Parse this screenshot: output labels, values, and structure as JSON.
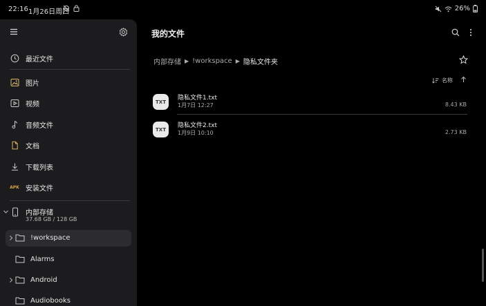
{
  "status": {
    "time": "22:16",
    "date": "1月26日周四",
    "battery": "26%",
    "left_icons": [
      "dnd-icon",
      "lock-icon"
    ],
    "right_icons": [
      "mute-icon",
      "wifi-icon",
      "battery-icon"
    ]
  },
  "sidebar": {
    "recent": "最近文件",
    "items": [
      {
        "label": "图片",
        "icon": "image-icon"
      },
      {
        "label": "视频",
        "icon": "video-icon"
      },
      {
        "label": "音频文件",
        "icon": "music-icon"
      },
      {
        "label": "文档",
        "icon": "document-icon"
      },
      {
        "label": "下载列表",
        "icon": "download-icon"
      },
      {
        "label": "安装文件",
        "icon": "apk-icon",
        "badge": "APK"
      }
    ],
    "storage": {
      "name": "内部存储",
      "capacity": "37.68 GB / 128 GB"
    },
    "folders": [
      {
        "label": "!workspace",
        "selected": true,
        "expandable": true
      },
      {
        "label": "Alarms",
        "selected": false,
        "expandable": false
      },
      {
        "label": "Android",
        "selected": false,
        "expandable": true
      },
      {
        "label": "Audiobooks",
        "selected": false,
        "expandable": false
      }
    ]
  },
  "main": {
    "title": "我的文件",
    "breadcrumb": [
      "内部存储",
      "!workspace",
      "隐私文件夹"
    ],
    "sort_label": "名称",
    "files": [
      {
        "type": "TXT",
        "name": "隐私文件1.txt",
        "date": "1月7日 12:27",
        "size": "8.43 KB"
      },
      {
        "type": "TXT",
        "name": "隐私文件2.txt",
        "date": "1月9日 10:10",
        "size": "2.73 KB"
      }
    ]
  },
  "colors": {
    "background": "#000000",
    "sidebar": "#1c1c1e",
    "selected": "#2c2c2e",
    "badge": "#eaeaea"
  }
}
